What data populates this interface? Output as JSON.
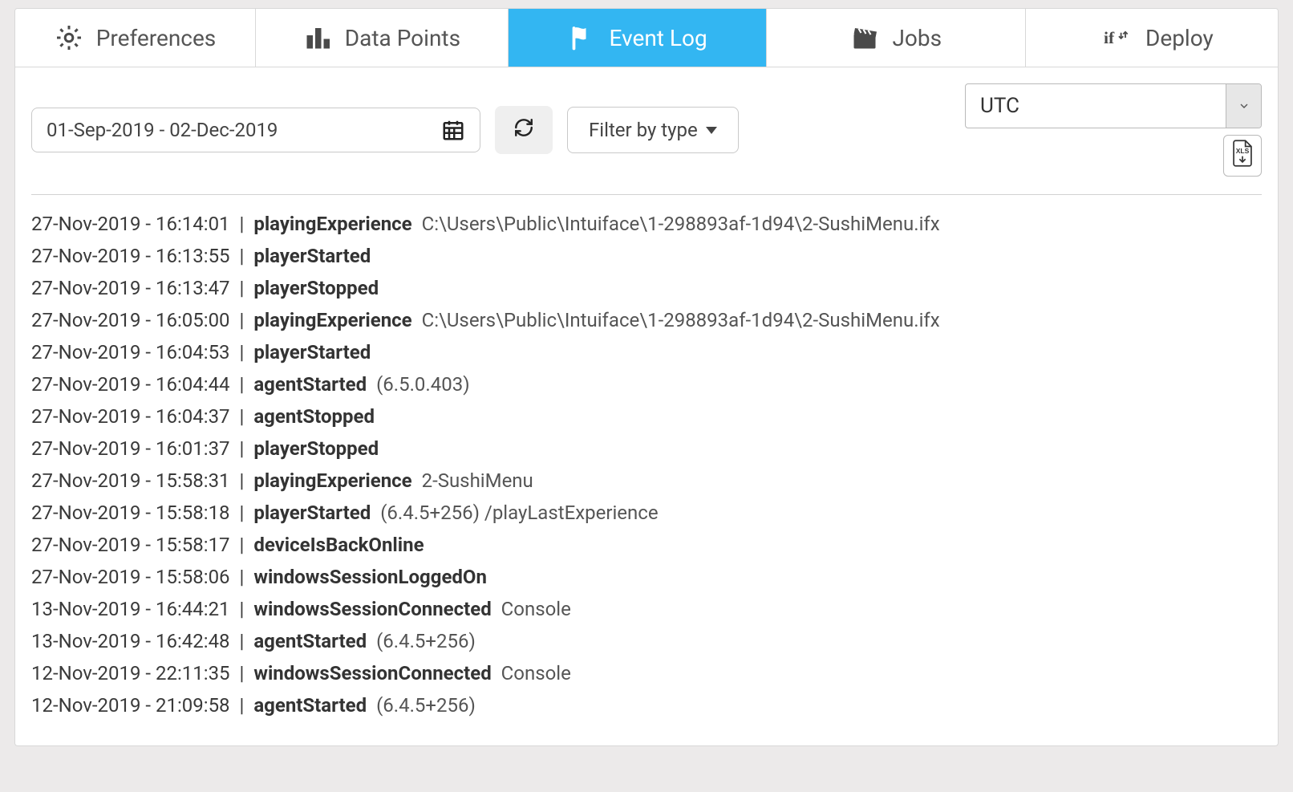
{
  "tabs": [
    {
      "label": "Preferences",
      "icon": "gear-icon",
      "active": false
    },
    {
      "label": "Data Points",
      "icon": "bars-icon",
      "active": false
    },
    {
      "label": "Event Log",
      "icon": "flag-icon",
      "active": true
    },
    {
      "label": "Jobs",
      "icon": "clapper-icon",
      "active": false
    },
    {
      "label": "Deploy",
      "icon": "if-icon",
      "active": false
    }
  ],
  "toolbar": {
    "date_range": "01-Sep-2019 - 02-Dec-2019",
    "filter_label": "Filter by type",
    "timezone": "UTC",
    "xls_label": "XLS"
  },
  "log": [
    {
      "ts": "27-Nov-2019 - 16:14:01",
      "event": "playingExperience",
      "detail": "C:\\Users\\Public\\Intuiface\\1-298893af-1d94\\2-SushiMenu.ifx"
    },
    {
      "ts": "27-Nov-2019 - 16:13:55",
      "event": "playerStarted",
      "detail": ""
    },
    {
      "ts": "27-Nov-2019 - 16:13:47",
      "event": "playerStopped",
      "detail": ""
    },
    {
      "ts": "27-Nov-2019 - 16:05:00",
      "event": "playingExperience",
      "detail": "C:\\Users\\Public\\Intuiface\\1-298893af-1d94\\2-SushiMenu.ifx"
    },
    {
      "ts": "27-Nov-2019 - 16:04:53",
      "event": "playerStarted",
      "detail": ""
    },
    {
      "ts": "27-Nov-2019 - 16:04:44",
      "event": "agentStarted",
      "detail": "(6.5.0.403)"
    },
    {
      "ts": "27-Nov-2019 - 16:04:37",
      "event": "agentStopped",
      "detail": ""
    },
    {
      "ts": "27-Nov-2019 - 16:01:37",
      "event": "playerStopped",
      "detail": ""
    },
    {
      "ts": "27-Nov-2019 - 15:58:31",
      "event": "playingExperience",
      "detail": "2-SushiMenu"
    },
    {
      "ts": "27-Nov-2019 - 15:58:18",
      "event": "playerStarted",
      "detail": "(6.4.5+256) /playLastExperience"
    },
    {
      "ts": "27-Nov-2019 - 15:58:17",
      "event": "deviceIsBackOnline",
      "detail": ""
    },
    {
      "ts": "27-Nov-2019 - 15:58:06",
      "event": "windowsSessionLoggedOn",
      "detail": ""
    },
    {
      "ts": "13-Nov-2019 - 16:44:21",
      "event": "windowsSessionConnected",
      "detail": "Console"
    },
    {
      "ts": "13-Nov-2019 - 16:42:48",
      "event": "agentStarted",
      "detail": "(6.4.5+256)"
    },
    {
      "ts": "12-Nov-2019 - 22:11:35",
      "event": "windowsSessionConnected",
      "detail": "Console"
    },
    {
      "ts": "12-Nov-2019 - 21:09:58",
      "event": "agentStarted",
      "detail": "(6.4.5+256)"
    }
  ]
}
